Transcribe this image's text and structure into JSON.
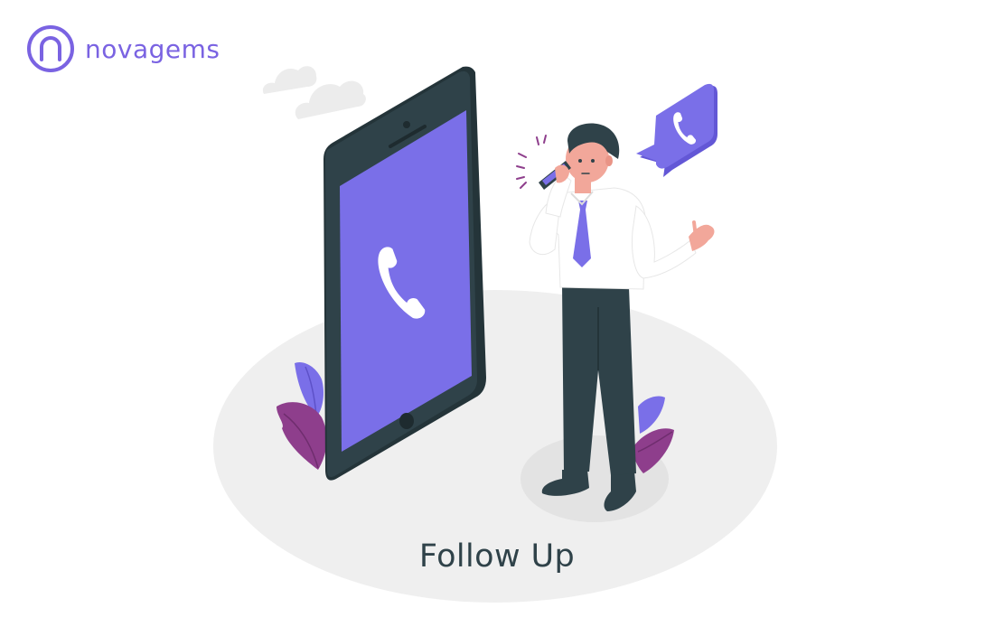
{
  "brand": {
    "name": "novagems",
    "logo_icon": "ring-logo-icon"
  },
  "caption": {
    "text": "Follow Up"
  },
  "illustration": {
    "subject": "phone-call-follow-up",
    "elements": [
      "cloud-icon",
      "smartphone-icon",
      "phone-handset-icon",
      "speech-bubble-phone-icon",
      "person-on-call",
      "plant-leaves"
    ]
  },
  "colors": {
    "accent": "#7A6FE8",
    "accent_dark": "#6357d6",
    "brand": "#7a63e2",
    "device": "#2F4249",
    "ground": "#EFEFEF",
    "leaf_purple": "#8E3E8C",
    "caption": "#2F4249"
  }
}
